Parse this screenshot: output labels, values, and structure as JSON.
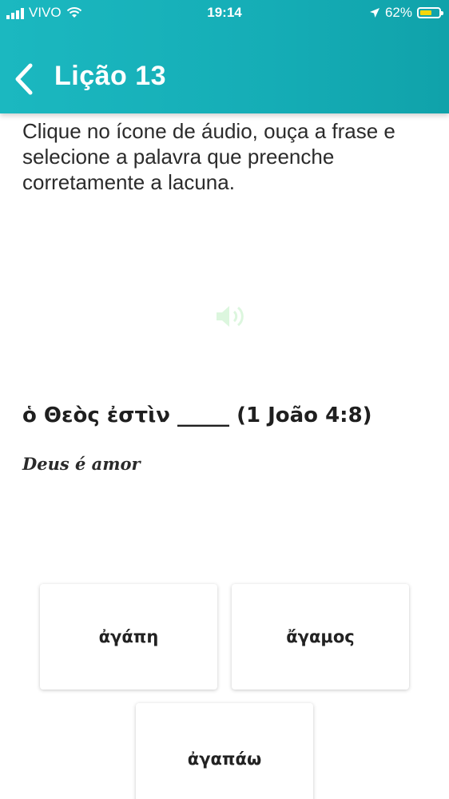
{
  "status_bar": {
    "carrier": "VIVO",
    "time": "19:14",
    "battery": "62%",
    "battery_level": 0.62
  },
  "nav": {
    "back_icon": "chevron-left-icon",
    "title": "Lição 13"
  },
  "exercise": {
    "instruction": "Clique no ícone de áudio, ouça a frase e selecione a palavra que preenche corretamente a lacuna.",
    "audio_icon": "speaker-icon",
    "sentence": "ὁ Θεὸς ἐστὶν _____ (1 João 4:8)",
    "translation": "Deus é amor"
  },
  "options": [
    {
      "label": "ἀγάπη"
    },
    {
      "label": "ἄγαμος"
    },
    {
      "label": "ἀγαπάω"
    }
  ],
  "colors": {
    "header": "#15adb6",
    "battery_fill": "#f5d70a"
  }
}
